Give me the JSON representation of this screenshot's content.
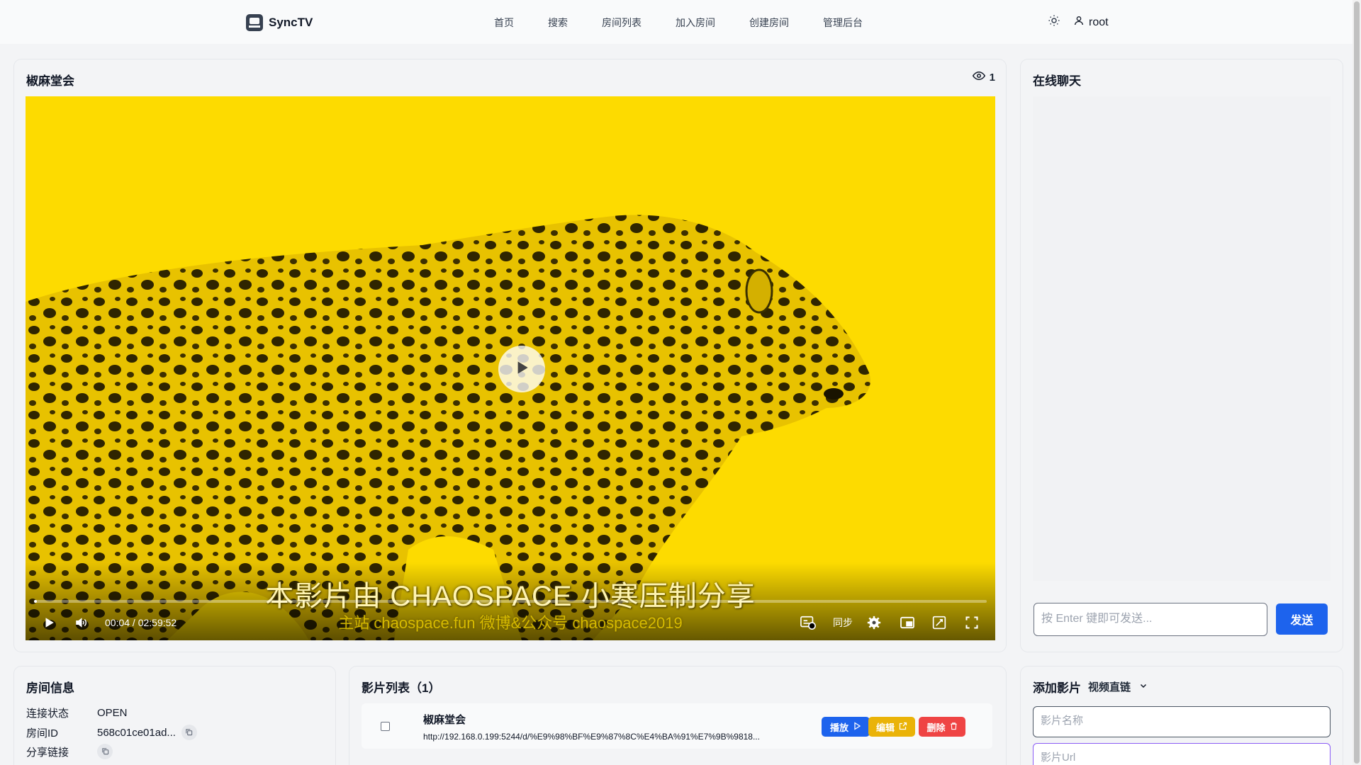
{
  "app": {
    "name": "SyncTV"
  },
  "nav": {
    "items": [
      "首页",
      "搜索",
      "房间列表",
      "加入房间",
      "创建房间",
      "管理后台"
    ]
  },
  "user": {
    "name": "root"
  },
  "icons": {
    "brand": "tv-icon",
    "theme": "sun-icon",
    "user": "user-icon",
    "viewers": "eye-icon"
  },
  "player": {
    "title": "椒麻堂会",
    "viewers": "1",
    "subtitle_line1": "本影片由 CHAOSPACE 小寒压制分享",
    "subtitle_line2": "主站 chaospace.fun 微博&公众号 chaospace2019",
    "time": "00:04 / 02:59:52",
    "progress": 0.0004,
    "sync_label": "同步"
  },
  "chat": {
    "title": "在线聊天",
    "input_placeholder": "按 Enter 键即可发送...",
    "send_label": "发送"
  },
  "room": {
    "title": "房间信息",
    "rows": [
      {
        "key": "连接状态",
        "value": "OPEN"
      },
      {
        "key": "房间ID",
        "value": "568c01ce01ad..."
      },
      {
        "key": "分享链接",
        "value": ""
      }
    ]
  },
  "movies": {
    "title": "影片列表（1）",
    "items": [
      {
        "name": "椒麻堂会",
        "url": "http://192.168.0.199:5244/d/%E9%98%BF%E9%87%8C%E4%BA%91%E7%9B%9818...",
        "play_label": "播放",
        "edit_label": "编辑",
        "delete_label": "删除"
      }
    ]
  },
  "add_movie": {
    "title": "添加影片",
    "mode": "视频直链",
    "name_placeholder": "影片名称",
    "url_placeholder": "影片Url"
  },
  "colors": {
    "primary": "#1d63ed",
    "warning": "#eab308",
    "danger": "#ef4444",
    "video_bg": "#fddb00"
  }
}
